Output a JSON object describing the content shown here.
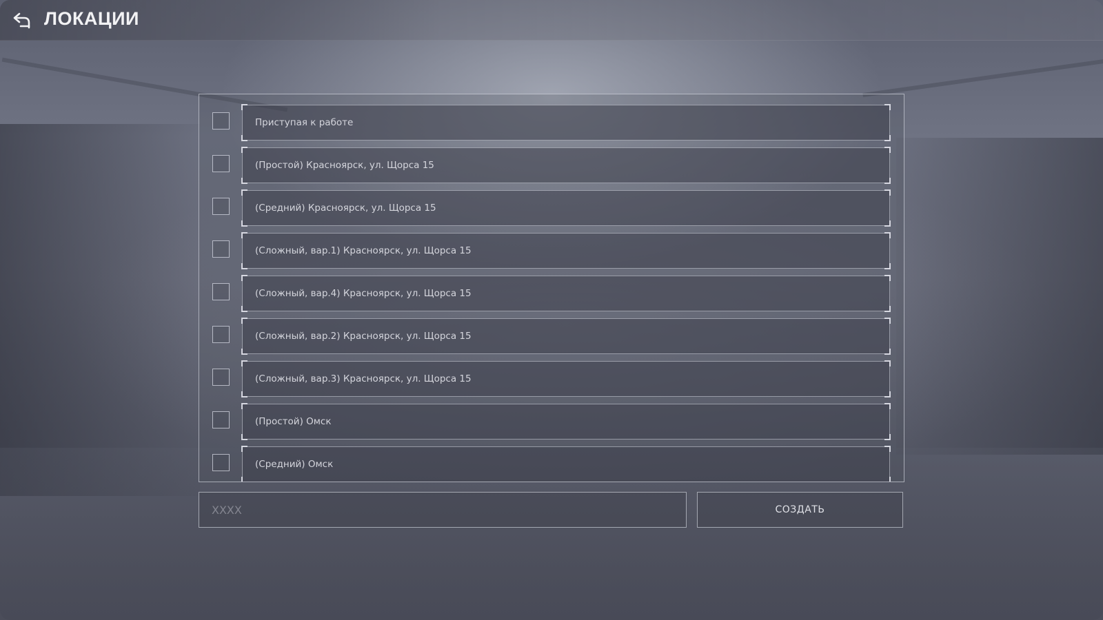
{
  "header": {
    "title": "ЛОКАЦИИ",
    "back_icon": "back-arrow-icon"
  },
  "locations": [
    {
      "label": "Приступая к работе",
      "checked": false
    },
    {
      "label": "(Простой) Красноярск, ул. Щорса 15",
      "checked": false
    },
    {
      "label": "(Средний) Красноярск, ул. Щорса 15",
      "checked": false
    },
    {
      "label": "(Сложный, вар.1) Красноярск, ул. Щорса 15",
      "checked": false
    },
    {
      "label": "(Сложный, вар.4) Красноярск, ул. Щорса 15",
      "checked": false
    },
    {
      "label": "(Сложный, вар.2) Красноярск, ул. Щорса 15",
      "checked": false
    },
    {
      "label": "(Сложный, вар.3) Красноярск, ул. Щорса 15",
      "checked": false
    },
    {
      "label": "(Простой) Омск",
      "checked": false
    },
    {
      "label": "(Средний) Омск",
      "checked": false
    }
  ],
  "name_input": {
    "placeholder": "XXXX",
    "value": ""
  },
  "create_button": {
    "label": "СОЗДАТЬ"
  }
}
